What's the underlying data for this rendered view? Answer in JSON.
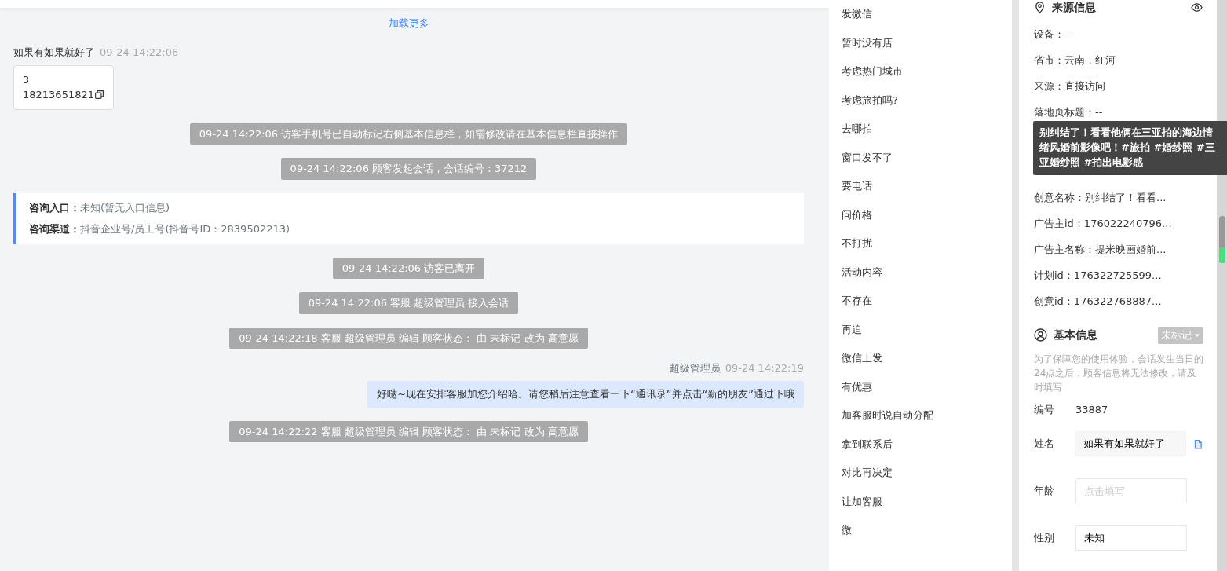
{
  "load_more": "加载更多",
  "messages": [
    {
      "kind": "visitor",
      "sender": "如果有如果就好了",
      "time": "09-24 14:22:06",
      "lines": [
        "3",
        "18213651821"
      ]
    },
    {
      "kind": "system",
      "text": "09-24 14:22:06 访客手机号已自动标记右侧基本信息栏，如需修改请在基本信息栏直接操作"
    },
    {
      "kind": "system",
      "text": "09-24 14:22:06 顾客发起会话，会话编号：37212"
    },
    {
      "kind": "entry",
      "fields": [
        {
          "label": "咨询入口：",
          "value": "未知(暂无入口信息)"
        },
        {
          "label": "咨询渠道：",
          "value": "抖音企业号/员工号(抖音号ID：2839502213)"
        }
      ]
    },
    {
      "kind": "system",
      "text": "09-24 14:22:06 访客已离开"
    },
    {
      "kind": "system",
      "text": "09-24 14:22:06 客服 超级管理员 接入会话"
    },
    {
      "kind": "system",
      "text": "09-24 14:22:18 客服 超级管理员 编辑 顾客状态： 由 未标记 改为 高意愿"
    },
    {
      "kind": "agent",
      "sender": "超级管理员",
      "time": "09-24 14:22:19",
      "text": "好哒~现在安排客服加您介绍哈。请您稍后注意查看一下“通讯录”并点击“新的朋友”通过下哦"
    },
    {
      "kind": "system",
      "text": "09-24 14:22:22 客服 超级管理员 编辑 顾客状态： 由 未标记 改为 高意愿"
    }
  ],
  "quick_replies": [
    "发微信",
    "暂时没有店",
    "考虑热门城市",
    "考虑旅拍吗?",
    "去哪拍",
    "窗口发不了",
    "要电话",
    "问价格",
    "不打扰",
    "活动内容",
    "不存在",
    "再追",
    "微信上发",
    "有优惠",
    "加客服时说自动分配",
    "拿到联系后",
    "对比再决定",
    "让加客服",
    "微"
  ],
  "source_info": {
    "title": "来源信息",
    "rows_before": [
      "设备：--",
      "省市：云南，红河",
      "来源：直接访问",
      "落地页标题：--"
    ],
    "tooltip": "别纠结了！看看他俩在三亚拍的海边情绪风婚前影像吧！#旅拍 #婚纱照 #三亚婚纱照 #拍出电影感",
    "rows_after": [
      "创意名称：别纠结了！看看...",
      "广告主id：176022240796...",
      "广告主名称：提米映画婚前...",
      "计划id：176322725599...",
      "创意id：176322768887..."
    ]
  },
  "basic_info": {
    "title": "基本信息",
    "status": "未标记",
    "notice": "为了保障您的使用体验，会话发生当日的24点之后，顾客信息将无法修改，请及时填写",
    "fields": [
      {
        "kind": "text",
        "label": "编号",
        "value": "33887"
      },
      {
        "kind": "input",
        "label": "姓名",
        "value": "如果有如果就好了",
        "readonly": true,
        "copyable": true
      },
      {
        "kind": "input",
        "label": "年龄",
        "placeholder": "点击填写",
        "readonly": false,
        "copyable": false
      },
      {
        "kind": "input",
        "label": "性别",
        "value": "未知",
        "readonly": false,
        "copyable": false
      }
    ]
  }
}
